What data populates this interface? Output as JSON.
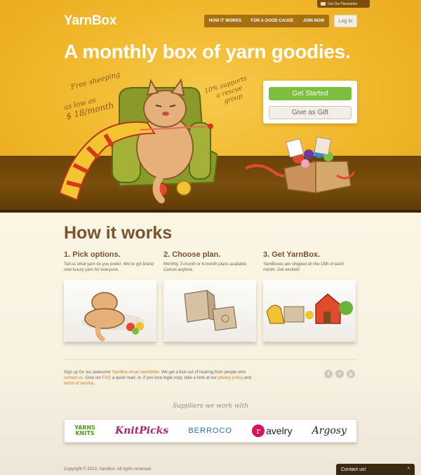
{
  "header": {
    "newsletter_tab": "Get Our Newsletter",
    "logo": "YarnBox",
    "nav": [
      "HOW IT WORKS",
      "FOR A GOOD CAUSE",
      "JOIN NOW"
    ],
    "login": "Log In"
  },
  "hero": {
    "headline": "A monthly box of yarn goodies.",
    "script_free_shipping": "Free sheeping",
    "script_price_line1": "as low as",
    "script_price_line2": "$ 18/month",
    "script_rescue_line1": "10% supports",
    "script_rescue_line2": "a rescue",
    "script_rescue_line3": "group",
    "get_started": "Get Started",
    "give_gift": "Give as Gift"
  },
  "how": {
    "title": "How it works",
    "steps": [
      {
        "title": "1. Pick options.",
        "text": "Tell us what yarn do you prefer. We've got brand new luxury yarn for everyone."
      },
      {
        "title": "2. Choose plan.",
        "text": "Monthly, 3-month or 6-month plans available. Cancel anytime."
      },
      {
        "title": "3. Get YarnBox.",
        "text": "YarnBoxes are shipped on the 15th of each month. Get excited!"
      }
    ]
  },
  "signup": {
    "p1": "Sign up for our awesome ",
    "link_newsletter": "YarnBox email newsletter",
    "p2": ". We get a kick out of hearing from people who ",
    "link_contact": "contact us",
    "p3": ". Give our ",
    "link_faq": "FAQ",
    "p4": " a quick read, or, if you love legal copy, take a look at our ",
    "link_privacy": "privacy policy",
    "p5": " and ",
    "link_terms": "terms of service",
    "p6": "."
  },
  "social": [
    "f",
    "t",
    "p"
  ],
  "suppliers": {
    "heading": "Suppliers we work with",
    "yarns_line1": "YARNS",
    "yarns_line2": "KNITS",
    "knitpicks": "KnitPicks",
    "berroco": "BERROCO",
    "ravelry_letter": "r",
    "ravelry": "avelry",
    "argosy": "Argosy"
  },
  "footer": {
    "copyright": "Copyright © 2013, YarnBox. All rights reserved.",
    "contact": "Contact us!",
    "contact_icon": "^"
  },
  "colors": {
    "hero_yellow": "#f1b72b",
    "floor_brown": "#6a4208",
    "accent_green": "#7cbf3f",
    "heading_brown": "#7a5330",
    "link_orange": "#d77b1d"
  }
}
